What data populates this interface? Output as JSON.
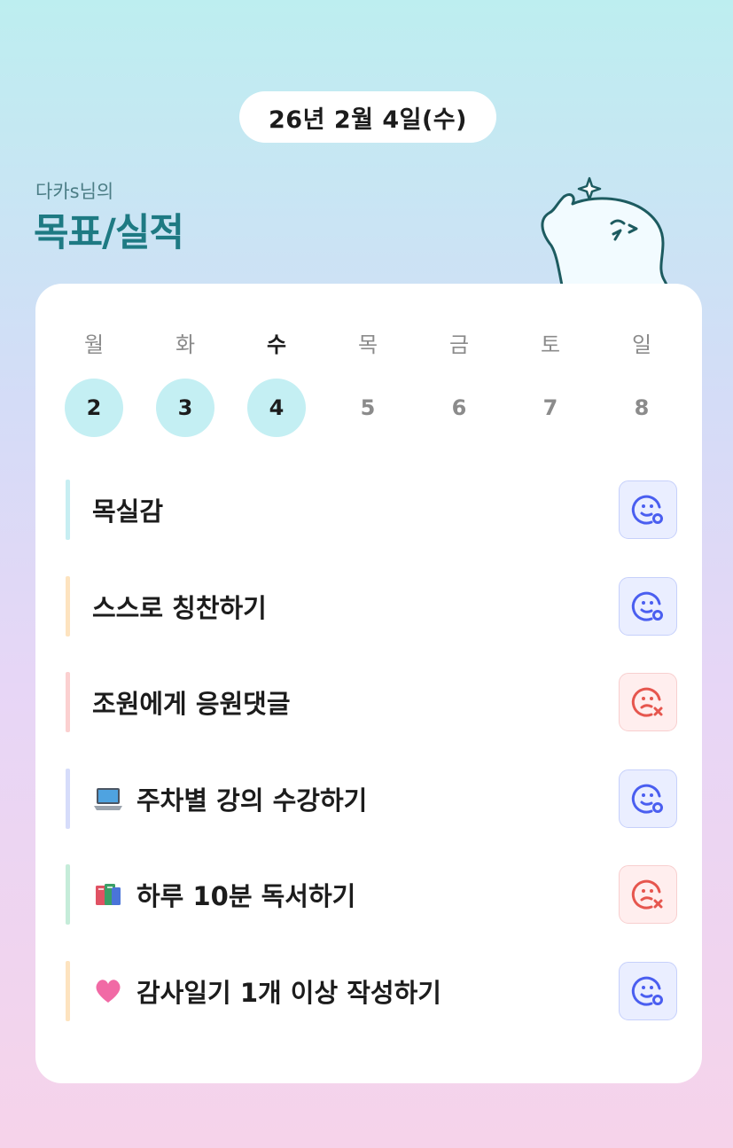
{
  "header": {
    "date": "26년 2월 4일(수)",
    "owner_label": "다카s님의",
    "title": "목표/실적"
  },
  "week": {
    "day_names": [
      "월",
      "화",
      "수",
      "목",
      "금",
      "토",
      "일"
    ],
    "day_numbers": [
      "2",
      "3",
      "4",
      "5",
      "6",
      "7",
      "8"
    ],
    "completed_days": [
      "2",
      "3",
      "4"
    ],
    "today": "수"
  },
  "goals": [
    {
      "label": "목실감",
      "emoji": "",
      "status": "achieved",
      "accent": "#c7eef2"
    },
    {
      "label": "스스로 칭찬하기",
      "emoji": "",
      "status": "achieved",
      "accent": "#fde3bf"
    },
    {
      "label": "조원에게 응원댓글",
      "emoji": "",
      "status": "missed",
      "accent": "#fbd0d0"
    },
    {
      "label": "주차별 강의 수강하기",
      "emoji": "laptop-icon",
      "status": "achieved",
      "accent": "#d6dcfa"
    },
    {
      "label": "하루 10분 독서하기",
      "emoji": "books-icon",
      "status": "missed",
      "accent": "#c5ecd9"
    },
    {
      "label": "감사일기 1개 이상 작성하기",
      "emoji": "pink-heart-icon",
      "status": "achieved",
      "accent": "#fde3bf"
    }
  ],
  "colors": {
    "title": "#1e7a83",
    "achieved_icon": "#4a5ef0",
    "missed_icon": "#e6564e",
    "completed_day_bg": "#c4eff3"
  }
}
